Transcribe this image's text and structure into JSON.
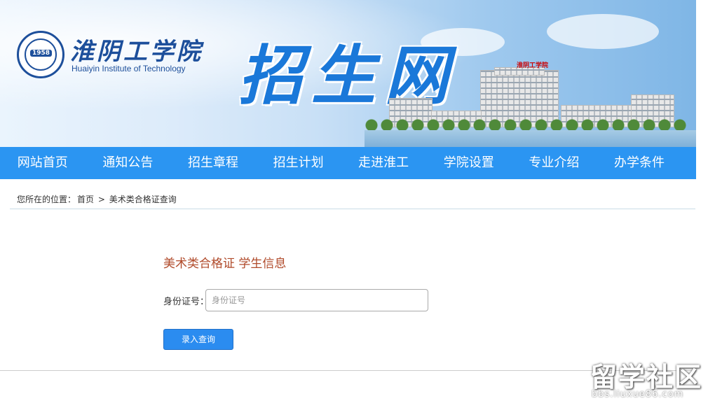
{
  "header": {
    "logo_cn": "淮阴工学院",
    "logo_en": "Huaiyin Institute of Technology",
    "logo_year": "1958",
    "banner_title": "招生网",
    "building_sign": "淮阴工学院"
  },
  "nav": {
    "items": [
      "网站首页",
      "通知公告",
      "招生章程",
      "招生计划",
      "走进淮工",
      "学院设置",
      "专业介绍",
      "办学条件"
    ]
  },
  "breadcrumb": {
    "prefix": "您所在的位置：",
    "home": "首页",
    "separator": ">",
    "current": "美术类合格证查询"
  },
  "form": {
    "title": "美术类合格证 学生信息",
    "id_label": "身份证号：",
    "id_value": "",
    "id_placeholder": "身份证号",
    "submit_label": "录入查询"
  },
  "watermark": {
    "cn": "留学社区",
    "en": "bbs.liuxue86.com"
  },
  "colors": {
    "nav_bg": "#2b95f2",
    "title_red": "#b04a2a",
    "button_blue": "#2b8cf0",
    "logo_blue": "#1d4f9b"
  }
}
